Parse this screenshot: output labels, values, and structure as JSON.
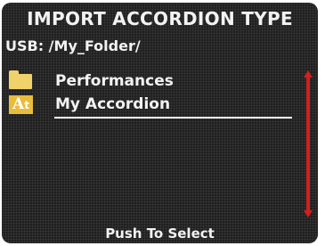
{
  "header": {
    "title": "IMPORT ACCORDION TYPE"
  },
  "location": {
    "path": "USB: /My_Folder/"
  },
  "file_list": {
    "items": [
      {
        "label": "Performances",
        "icon": "folder-icon"
      },
      {
        "label": "My Accordion",
        "icon": "accordion-file-icon",
        "icon_text": "A",
        "icon_subtext": "t",
        "selected": true
      }
    ]
  },
  "footer": {
    "hint": "Push To Select"
  },
  "colors": {
    "background": "#1c1c1c",
    "text": "#f2f2f2",
    "folder": "#f0d26a",
    "accordion_icon": "#e9bc3a",
    "scrollbar": "#d21f1f"
  }
}
